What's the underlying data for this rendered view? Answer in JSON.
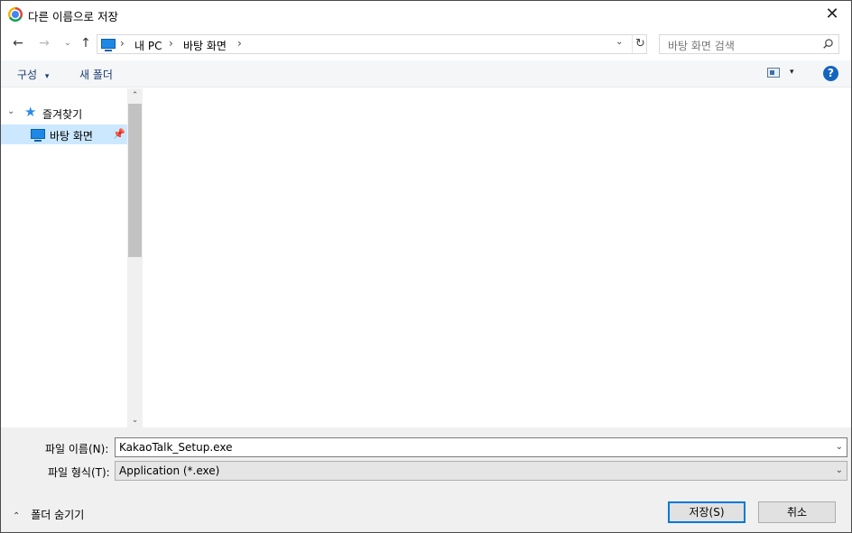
{
  "window": {
    "title": "다른 이름으로 저장",
    "close_glyph": "✕"
  },
  "nav": {
    "back_glyph": "←",
    "forward_glyph": "→",
    "recent_glyph": "⌄",
    "up_glyph": "↑",
    "address": {
      "crumbs": [
        "내 PC",
        "바탕 화면"
      ],
      "separator": "›",
      "refresh_glyph": "↻",
      "dropdown_glyph": "⌄"
    },
    "search": {
      "placeholder": "바탕 화면 검색"
    }
  },
  "toolbar": {
    "organize_label": "구성",
    "new_folder_label": "새 폴더",
    "help_label": "?",
    "caret_glyph": "▾"
  },
  "navpane": {
    "favorites_label": "즐겨찾기",
    "desktop_label": "바탕 화면",
    "expander_glyph": "⌄",
    "star_glyph": "★",
    "pin_glyph": "📌",
    "scroll_up_glyph": "⌃",
    "scroll_down_glyph": "⌄"
  },
  "form": {
    "filename_label": "파일 이름(N):",
    "filename_value": "KakaoTalk_Setup.exe",
    "filetype_label": "파일 형식(T):",
    "filetype_value": "Application (*.exe)",
    "caret_glyph": "⌄"
  },
  "footer": {
    "hide_folders_label": "폴더 숨기기",
    "hide_caret": "⌃",
    "save_label": "저장(S)",
    "cancel_label": "취소"
  },
  "colors": {
    "accent": "#0078d7",
    "selected_bg": "#cce8ff",
    "help_blue": "#1565c0"
  }
}
